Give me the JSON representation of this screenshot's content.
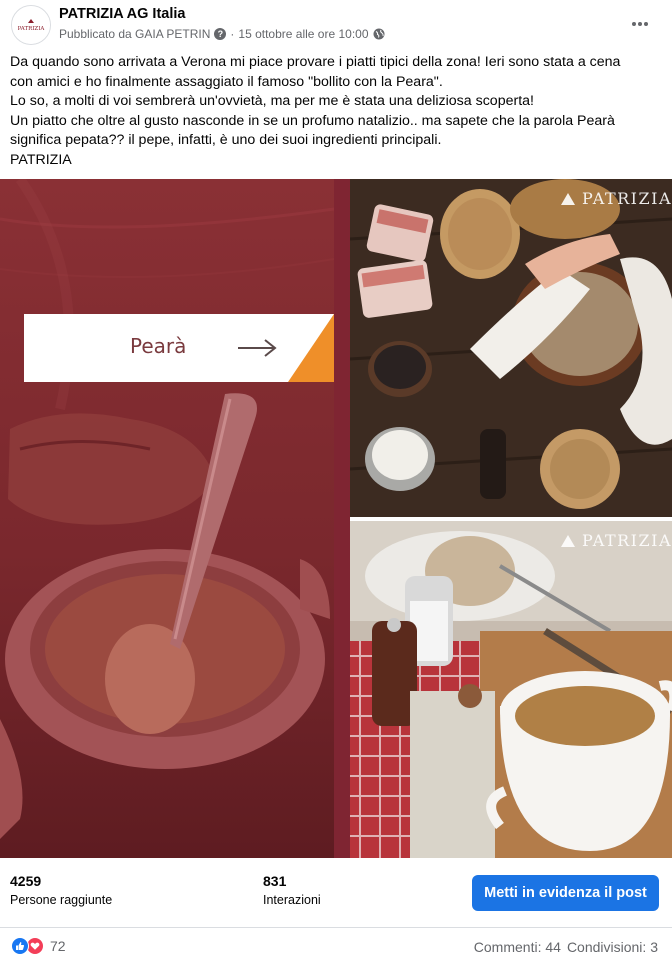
{
  "post": {
    "page_name": "PATRIZIA AG Italia",
    "published_by": "Pubblicato da GAIA PETRIN",
    "separator": "·",
    "date": "15 ottobre alle ore 10:00",
    "avatar_logo_text": "PATRIZIA",
    "text_lines": [
      "Da quando sono arrivata a Verona mi piace provare i piatti tipici della zona! Ieri sono stata a cena",
      "con amici e ho finalmente assaggiato il famoso \"bollito con la Peara\".",
      "Lo so, a molti di voi sembrerà un'ovvietà, ma per me è stata una deliziosa scoperta!",
      "Un piatto che oltre al gusto nasconde in se un profumo natalizio.. ma sapete che la parola Pearà",
      "significa pepata??  il pepe, infatti, è uno dei suoi ingredienti principali.",
      "PATRIZIA"
    ]
  },
  "photos": {
    "banner_label": "Pearà",
    "watermark": "PATRIZIA"
  },
  "insights": {
    "reach_value": "4259",
    "reach_label": "Persone raggiunte",
    "interactions_value": "831",
    "interactions_label": "Interazioni",
    "boost_label": "Metti in evidenza il post"
  },
  "footer": {
    "reaction_count": "72",
    "comments": "Commenti: 44",
    "shares": "Condivisioni: 3"
  },
  "icons": {
    "more": "more-horizontal-icon",
    "question": "question-icon",
    "globe": "globe-icon",
    "arrow": "arrow-right-icon",
    "like": "like-icon",
    "love": "love-icon"
  },
  "colors": {
    "accent": "#1b74e4",
    "secondary_text": "#65676b",
    "banner_orange": "#ef8f29",
    "maroon_overlay": "#7e2a2f"
  }
}
